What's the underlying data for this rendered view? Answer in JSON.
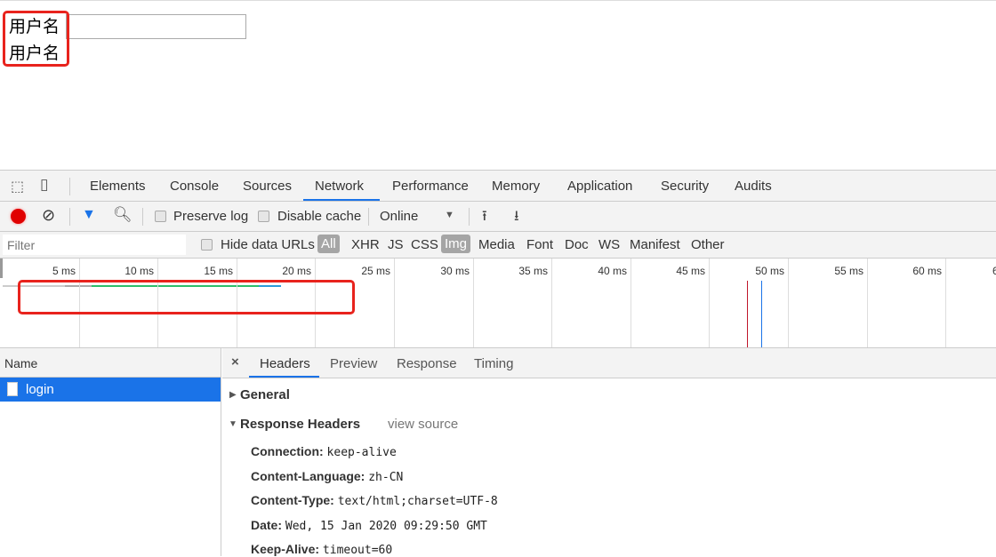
{
  "page": {
    "labels": [
      "用户名",
      "用户名"
    ],
    "input_value": ""
  },
  "devtools": {
    "tabs": [
      "Elements",
      "Console",
      "Sources",
      "Network",
      "Performance",
      "Memory",
      "Application",
      "Security",
      "Audits"
    ],
    "active_tab": "Network",
    "toolbar": {
      "preserve_log": "Preserve log",
      "disable_cache": "Disable cache",
      "throttle": "Online"
    },
    "filter": {
      "placeholder": "Filter",
      "hide_data_urls": "Hide data URLs",
      "types": [
        "All",
        "XHR",
        "JS",
        "CSS",
        "Img",
        "Media",
        "Font",
        "Doc",
        "WS",
        "Manifest",
        "Other"
      ],
      "active_types": [
        "All",
        "Img"
      ]
    },
    "timeline": {
      "ticks": [
        "5 ms",
        "10 ms",
        "15 ms",
        "20 ms",
        "25 ms",
        "30 ms",
        "35 ms",
        "40 ms",
        "45 ms",
        "50 ms",
        "55 ms",
        "60 ms",
        "6"
      ]
    },
    "requests": {
      "header": "Name",
      "items": [
        "login"
      ]
    },
    "detail_tabs": [
      "Headers",
      "Preview",
      "Response",
      "Timing"
    ],
    "general": "General",
    "response_headers": {
      "title": "Response Headers",
      "view_source": "view source",
      "items": [
        {
          "k": "Connection:",
          "v": "keep-alive"
        },
        {
          "k": "Content-Language:",
          "v": "zh-CN"
        },
        {
          "k": "Content-Type:",
          "v": "text/html;charset=UTF-8"
        },
        {
          "k": "Date:",
          "v": "Wed, 15 Jan 2020 09:29:50 GMT"
        },
        {
          "k": "Keep-Alive:",
          "v": "timeout=60"
        }
      ]
    }
  },
  "colors": {
    "accent": "#1a73e8",
    "highlight": "#e8231d",
    "record": "#e00000"
  }
}
